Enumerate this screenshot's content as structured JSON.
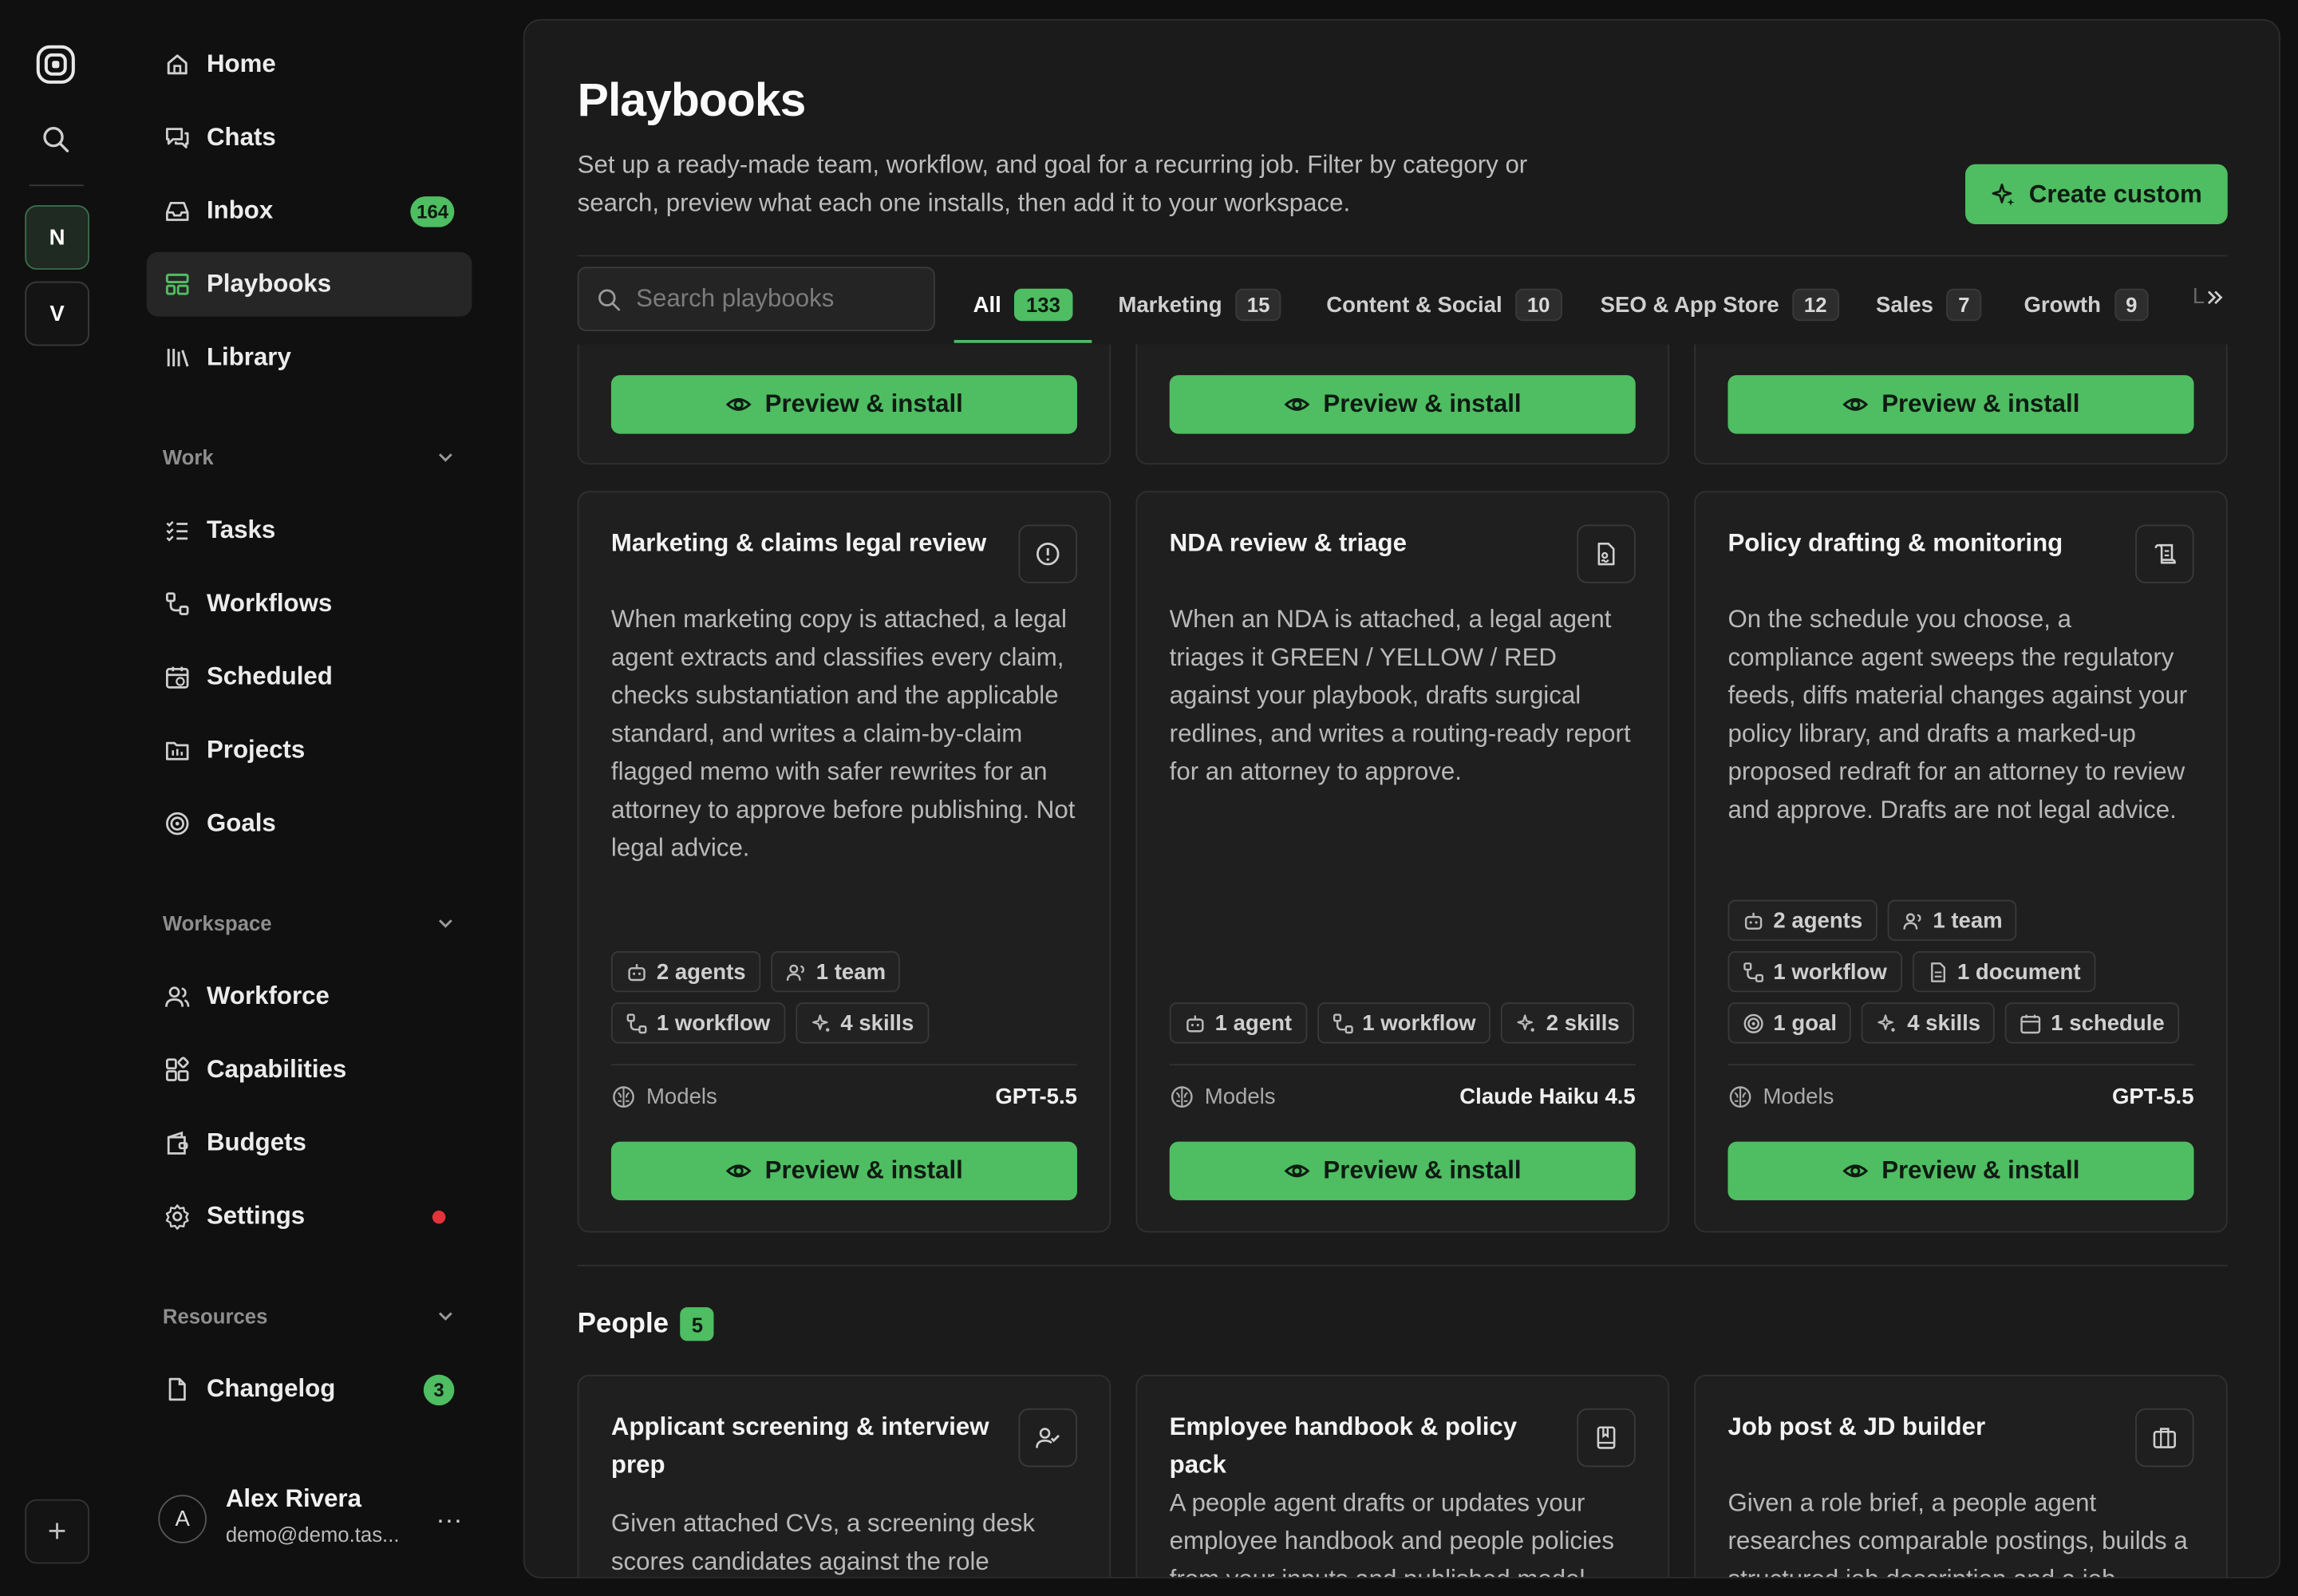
{
  "sidebar": {
    "workspaces": [
      "N",
      "V"
    ],
    "nav_top": [
      {
        "label": "Home",
        "icon": "home-icon"
      },
      {
        "label": "Chats",
        "icon": "chats-icon"
      },
      {
        "label": "Inbox",
        "icon": "inbox-icon",
        "badge": "164"
      },
      {
        "label": "Playbooks",
        "icon": "playbooks-icon",
        "active": true
      },
      {
        "label": "Library",
        "icon": "library-icon"
      }
    ],
    "work_title": "Work",
    "work_items": [
      {
        "label": "Tasks",
        "icon": "tasks-icon"
      },
      {
        "label": "Workflows",
        "icon": "workflows-icon"
      },
      {
        "label": "Scheduled",
        "icon": "calendar-icon"
      },
      {
        "label": "Projects",
        "icon": "projects-icon"
      },
      {
        "label": "Goals",
        "icon": "goals-icon"
      }
    ],
    "workspace_title": "Workspace",
    "workspace_items": [
      {
        "label": "Workforce",
        "icon": "users-icon"
      },
      {
        "label": "Capabilities",
        "icon": "capabilities-icon"
      },
      {
        "label": "Budgets",
        "icon": "budgets-icon"
      },
      {
        "label": "Settings",
        "icon": "gear-icon",
        "dot": true
      }
    ],
    "resources_title": "Resources",
    "resources_items": [
      {
        "label": "Changelog",
        "icon": "document-icon",
        "badge": "3"
      }
    ],
    "user": {
      "initial": "A",
      "name": "Alex Rivera",
      "email": "demo@demo.tas...",
      "more": "..."
    },
    "add_label": "+"
  },
  "main": {
    "title": "Playbooks",
    "description": "Set up a ready-made team, workflow, and goal for a recurring job. Filter by category or search, preview what each one installs, then add it to your workspace.",
    "create_label": "Create custom",
    "search_placeholder": "Search playbooks",
    "tabs": [
      {
        "label": "All",
        "count": "133",
        "active": true
      },
      {
        "label": "Marketing",
        "count": "15"
      },
      {
        "label": "Content & Social",
        "count": "10"
      },
      {
        "label": "SEO & App Store",
        "count": "12"
      },
      {
        "label": "Sales",
        "count": "7"
      },
      {
        "label": "Growth",
        "count": "9"
      }
    ],
    "tabs_overflow": "L",
    "preview_label": "Preview & install",
    "models_label": "Models",
    "legal_cards": [
      {
        "title": "Marketing & claims legal review",
        "icon": "alert-circle-icon",
        "description": "When marketing copy is attached, a legal agent extracts and classifies every claim, checks substantiation and the applicable standard, and writes a claim-by-claim flagged memo with safer rewrites for an attorney to approve before publishing. Not legal advice.",
        "chips": [
          {
            "label": "2 agents",
            "icon": "bot-icon"
          },
          {
            "label": "1 team",
            "icon": "team-icon"
          },
          {
            "label": "1 workflow",
            "icon": "workflow-icon"
          },
          {
            "label": "4 skills",
            "icon": "sparkles-icon"
          }
        ],
        "model": "GPT-5.5"
      },
      {
        "title": "NDA review & triage",
        "icon": "file-signature-icon",
        "description": "When an NDA is attached, a legal agent triages it GREEN / YELLOW / RED against your playbook, drafts surgical redlines, and writes a routing-ready report for an attorney to approve.",
        "chips": [
          {
            "label": "1 agent",
            "icon": "bot-icon"
          },
          {
            "label": "1 workflow",
            "icon": "workflow-icon"
          },
          {
            "label": "2 skills",
            "icon": "sparkles-icon"
          }
        ],
        "model": "Claude Haiku 4.5"
      },
      {
        "title": "Policy drafting & monitoring",
        "icon": "scroll-icon",
        "description": "On the schedule you choose, a compliance agent sweeps the regulatory feeds, diffs material changes against your policy library, and drafts a marked-up proposed redraft for an attorney to review and approve. Drafts are not legal advice.",
        "chips": [
          {
            "label": "2 agents",
            "icon": "bot-icon"
          },
          {
            "label": "1 team",
            "icon": "team-icon"
          },
          {
            "label": "1 workflow",
            "icon": "workflow-icon"
          },
          {
            "label": "1 document",
            "icon": "document-icon"
          },
          {
            "label": "1 goal",
            "icon": "target-icon"
          },
          {
            "label": "4 skills",
            "icon": "sparkles-icon"
          },
          {
            "label": "1 schedule",
            "icon": "calendar-icon"
          }
        ],
        "model": "GPT-5.5"
      }
    ],
    "people_section": {
      "title": "People",
      "count": "5"
    },
    "people_cards": [
      {
        "title": "Applicant screening & interview prep",
        "icon": "user-check-icon",
        "description": "Given attached CVs, a screening desk scores candidates against the role"
      },
      {
        "title": "Employee handbook & policy pack",
        "icon": "book-icon",
        "description": "A people agent drafts or updates your employee handbook and people policies from your inputs and published model"
      },
      {
        "title": "Job post & JD builder",
        "icon": "briefcase-icon",
        "description": "Given a role brief, a people agent researches comparable postings, builds a structured job description and a job"
      }
    ]
  }
}
